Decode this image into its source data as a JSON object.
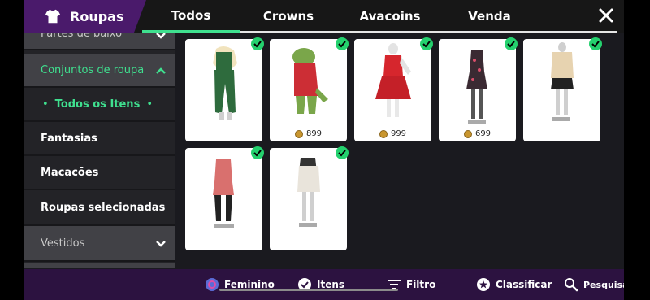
{
  "header": {
    "title": "Roupas",
    "tabs": [
      {
        "label": "Todos",
        "active": true
      },
      {
        "label": "Crowns",
        "active": false
      },
      {
        "label": "Avacoins",
        "active": false
      },
      {
        "label": "Venda",
        "active": false
      }
    ]
  },
  "sidebar": {
    "items": [
      {
        "label": "Partes de baixo"
      },
      {
        "label": "Conjuntos de roupa"
      },
      {
        "label": "Todos os Itens"
      },
      {
        "label": "Fantasias"
      },
      {
        "label": "Macacões"
      },
      {
        "label": "Roupas selecionadas"
      },
      {
        "label": "Vestidos"
      }
    ]
  },
  "items": [
    {
      "price": "",
      "owned": true
    },
    {
      "price": "899",
      "owned": true
    },
    {
      "price": "999",
      "owned": true
    },
    {
      "price": "699",
      "owned": true
    },
    {
      "price": "",
      "owned": true
    },
    {
      "price": "",
      "owned": true
    },
    {
      "price": "",
      "owned": true
    }
  ],
  "bottombar": {
    "feminino": "Feminino",
    "itens": "Itens",
    "filtro": "Filtro",
    "classificar": "Classificar",
    "pesquisa": "Pesquisa"
  },
  "colors": {
    "accent": "#3fe08f",
    "header_purple": "#4a1a6b",
    "bottom_purple": "#2c1240",
    "check_green": "#24d16e"
  },
  "icons": [
    "shirt-icon",
    "close-icon",
    "chevron-up-icon",
    "chevron-down-icon",
    "check-icon",
    "coin-icon",
    "gender-icon",
    "filter-icon",
    "star-icon",
    "search-icon"
  ]
}
